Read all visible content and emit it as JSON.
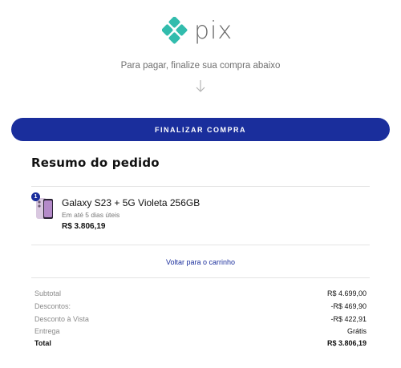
{
  "brand": {
    "logo_text": "pix",
    "accent": "#1a2e9c",
    "logo_color": "#32bcad",
    "icon": "pix-diamond-icon"
  },
  "header": {
    "instruction": "Para pagar, finalize sua compra abaixo",
    "arrow_icon": "arrow-down-icon"
  },
  "checkout": {
    "button_label": "FINALIZAR COMPRA"
  },
  "summary": {
    "title": "Resumo do pedido",
    "item": {
      "quantity": "1",
      "name": "Galaxy S23 + 5G Violeta 256GB",
      "delivery": "Em até 5 dias úteis",
      "price": "R$ 3.806,19"
    },
    "back_link": "Voltar para o carrinho",
    "totals": [
      {
        "label": "Subtotal",
        "value": "R$ 4.699,00"
      },
      {
        "label": "Descontos:",
        "value": "-R$ 469,90"
      },
      {
        "label": "Desconto à Vista",
        "value": "-R$ 422,91"
      },
      {
        "label": "Entrega",
        "value": "Grátis"
      },
      {
        "label": "Total",
        "value": "R$ 3.806,19"
      }
    ]
  }
}
